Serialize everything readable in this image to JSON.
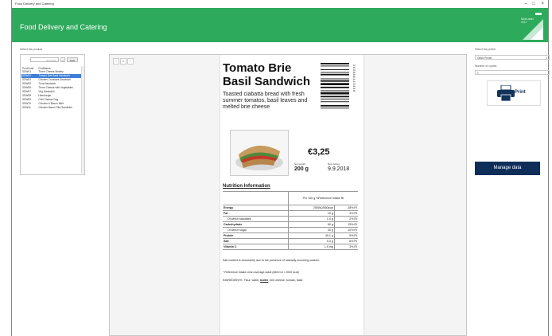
{
  "window": {
    "title": "Food Delivery and Catering",
    "controls": [
      "–",
      "□",
      "×"
    ]
  },
  "header": {
    "app_title": "Food Delivery and Catering",
    "logo_text": "NiceLabel 2017",
    "accent_color": "#2eaa5c"
  },
  "left": {
    "select_label": "Select the product",
    "search_placeholder": "Find next",
    "clear_icon": "×",
    "find_label": "Find",
    "columns": [
      "ProdCode",
      "ProdName"
    ],
    "rows": [
      {
        "code": "SDW01",
        "name": "Three Cheese Medley"
      },
      {
        "code": "SDW02",
        "name": "Tomato Brie Basil Sandwich",
        "selected": true
      },
      {
        "code": "SDW03",
        "name": "Chicken Croissant Sandwich"
      },
      {
        "code": "SDW05",
        "name": "Tuna Sandwich"
      },
      {
        "code": "SDW06",
        "name": "Three Cheese with Vegetables"
      },
      {
        "code": "SDW07",
        "name": "Veg Sandwich"
      },
      {
        "code": "SDW08",
        "name": "Hamburger"
      },
      {
        "code": "SDW09",
        "name": "Chili Cheese Dog"
      },
      {
        "code": "SDW10",
        "name": "Chicken & Bacon Melt"
      },
      {
        "code": "SDW11",
        "name": "Chicken Bacon Pita Sandwich"
      }
    ]
  },
  "preview": {
    "nav": [
      "‹",
      "1",
      "›"
    ],
    "product_name": "Tomato Brie Basil Sandwich",
    "description": "Toasted ciabatta bread with fresh summer tomatos, basil leaves and melted brie cheese",
    "barcode_digits": "3 8 3 8 8 8 1 2 3 4 5 6",
    "price": "€3,25",
    "net_weight_label": "Net weight",
    "net_weight": "200 g",
    "best_before_label": "Best before",
    "best_before": "9.9.2018",
    "nutrition_title": "Nutrition Information",
    "nutrition_header": "Per 100 g %Reference Intake RI",
    "nutrition_rows": [
      {
        "name": "Energy",
        "value": "2500kJ/560kcal",
        "ri": "28% RI",
        "bold": true
      },
      {
        "name": "Fat",
        "value": "10 g",
        "ri": "4% RI",
        "bold": true
      },
      {
        "name": "Of which saturates",
        "value": "1.4 g",
        "ri": "2% RI",
        "indent": true
      },
      {
        "name": "Carbohydrate",
        "value": "60 g",
        "ri": "15% RI",
        "bold": true
      },
      {
        "name": "Of which sugar",
        "value": "30 g",
        "ri": "10% RI",
        "indent": true
      },
      {
        "name": "Protein",
        "value": "40.1 g",
        "ri": "5% RI",
        "bold": true
      },
      {
        "name": "Salt",
        "value": "0.3 g",
        "ri": "6% RI",
        "bold": true
      },
      {
        "name": "Vitamin C",
        "value": "1.5 mg",
        "ri": "3% RI",
        "bold": true
      }
    ],
    "salt_note": "Salt content is exclusively due to the presence of naturally occurring sodium.",
    "ri_note": "* Reference intake of an average adult (8400 kJ / 2000 kcal)",
    "ingredients_label": "INGREDIENTS",
    "ingredients_pre": "Flour, water, ",
    "ingredients_allergen": "butter",
    "ingredients_post": ", brie cheese, tomato, basil"
  },
  "right": {
    "printer_label": "Select the printer",
    "printer_value": "Office Printer",
    "copies_label": "Number of copies",
    "copies_value": "1",
    "print_label": "Print",
    "manage_label": "Manage data"
  }
}
